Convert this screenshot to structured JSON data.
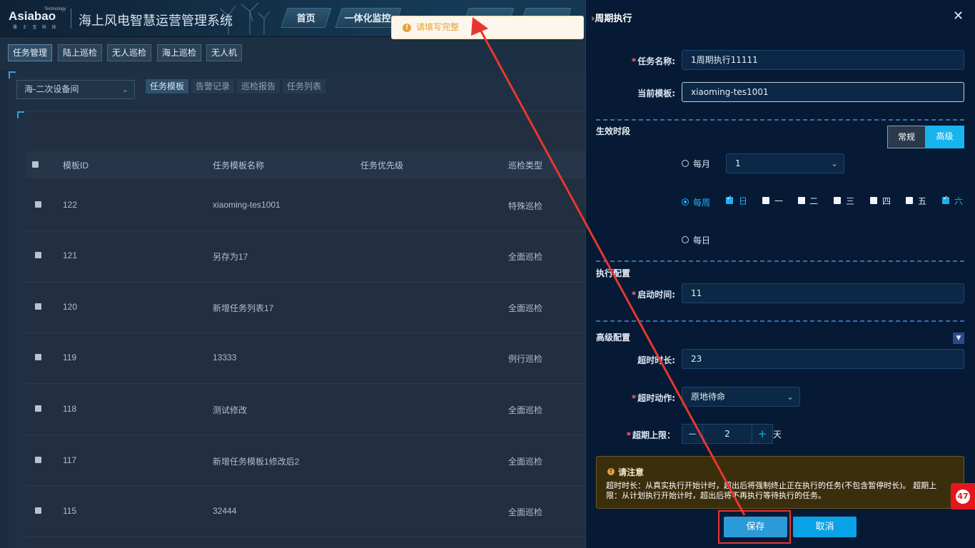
{
  "header": {
    "brand": "Asiabao",
    "brand_tech": "Technology",
    "brand_sub": "雅 士 宝 科 技",
    "system_title": "海上风电智慧运营管理系统",
    "nav_tabs": [
      "首页",
      "一体化监控"
    ]
  },
  "subnav": {
    "tabs": [
      "任务管理",
      "陆上巡检",
      "无人巡检",
      "海上巡检",
      "无人机"
    ]
  },
  "filters": {
    "site_select": "海-二次设备间",
    "template_tabs": [
      "任务模板",
      "告警记录",
      "巡检报告",
      "任务列表"
    ]
  },
  "table": {
    "headers": [
      "模板ID",
      "任务模板名称",
      "任务优先级",
      "巡检类型"
    ],
    "rows": [
      {
        "id": "122",
        "name": "xiaoming-tes1001",
        "priority": "",
        "type": "特殊巡检"
      },
      {
        "id": "121",
        "name": "另存为17",
        "priority": "",
        "type": "全面巡检"
      },
      {
        "id": "120",
        "name": "新增任务列表17",
        "priority": "",
        "type": "全面巡检"
      },
      {
        "id": "119",
        "name": "13333",
        "priority": "",
        "type": "例行巡检"
      },
      {
        "id": "118",
        "name": "测试修改",
        "priority": "",
        "type": "全面巡检"
      },
      {
        "id": "117",
        "name": "新增任务模板1修改后2",
        "priority": "",
        "type": "全面巡检"
      },
      {
        "id": "115",
        "name": "32444",
        "priority": "",
        "type": "全面巡检"
      }
    ]
  },
  "toast": {
    "message": "请填写完整",
    "type": "warning",
    "color": "#e6a23c"
  },
  "drawer": {
    "title": "周期执行",
    "task_name_label": "任务名称:",
    "task_name_value": "1周期执行11111",
    "template_label": "当前模板:",
    "template_value": "xiaoming-tes1001",
    "effective_section": "生效时段",
    "mode_buttons": [
      "常规",
      "高级"
    ],
    "mode_selected": "高级",
    "monthly_label": "每月",
    "monthly_value": "1",
    "weekly_label": "每周",
    "daily_label": "每日",
    "frequency_selected": "每周",
    "weekdays": [
      {
        "label": "日",
        "checked": true
      },
      {
        "label": "一",
        "checked": false
      },
      {
        "label": "二",
        "checked": false
      },
      {
        "label": "三",
        "checked": false
      },
      {
        "label": "四",
        "checked": false
      },
      {
        "label": "五",
        "checked": false
      },
      {
        "label": "六",
        "checked": true
      }
    ],
    "exec_section": "执行配置",
    "start_time_label": "启动时间:",
    "start_time_value": "11",
    "advanced_section": "高级配置",
    "timeout_label": "超时时长:",
    "timeout_value": "23",
    "timeout_action_label": "超时动作:",
    "timeout_action_value": "原地待命",
    "overdue_label": "超期上限：",
    "overdue_value": "2",
    "overdue_unit": "天",
    "notice_title": "请注意",
    "notice_text": "超时时长：从真实执行开始计时，超出后将强制终止正在执行的任务(不包含暂停时长)。 超期上限：从计划执行开始计时，超出后将不再执行等待执行的任务。",
    "save_label": "保存",
    "cancel_label": "取消"
  },
  "badge": {
    "count": "47"
  },
  "colors": {
    "accent": "#18b4ee",
    "save": "#2b9ad6",
    "cancel": "#0aa2e6",
    "annotation": "#e8362f"
  }
}
